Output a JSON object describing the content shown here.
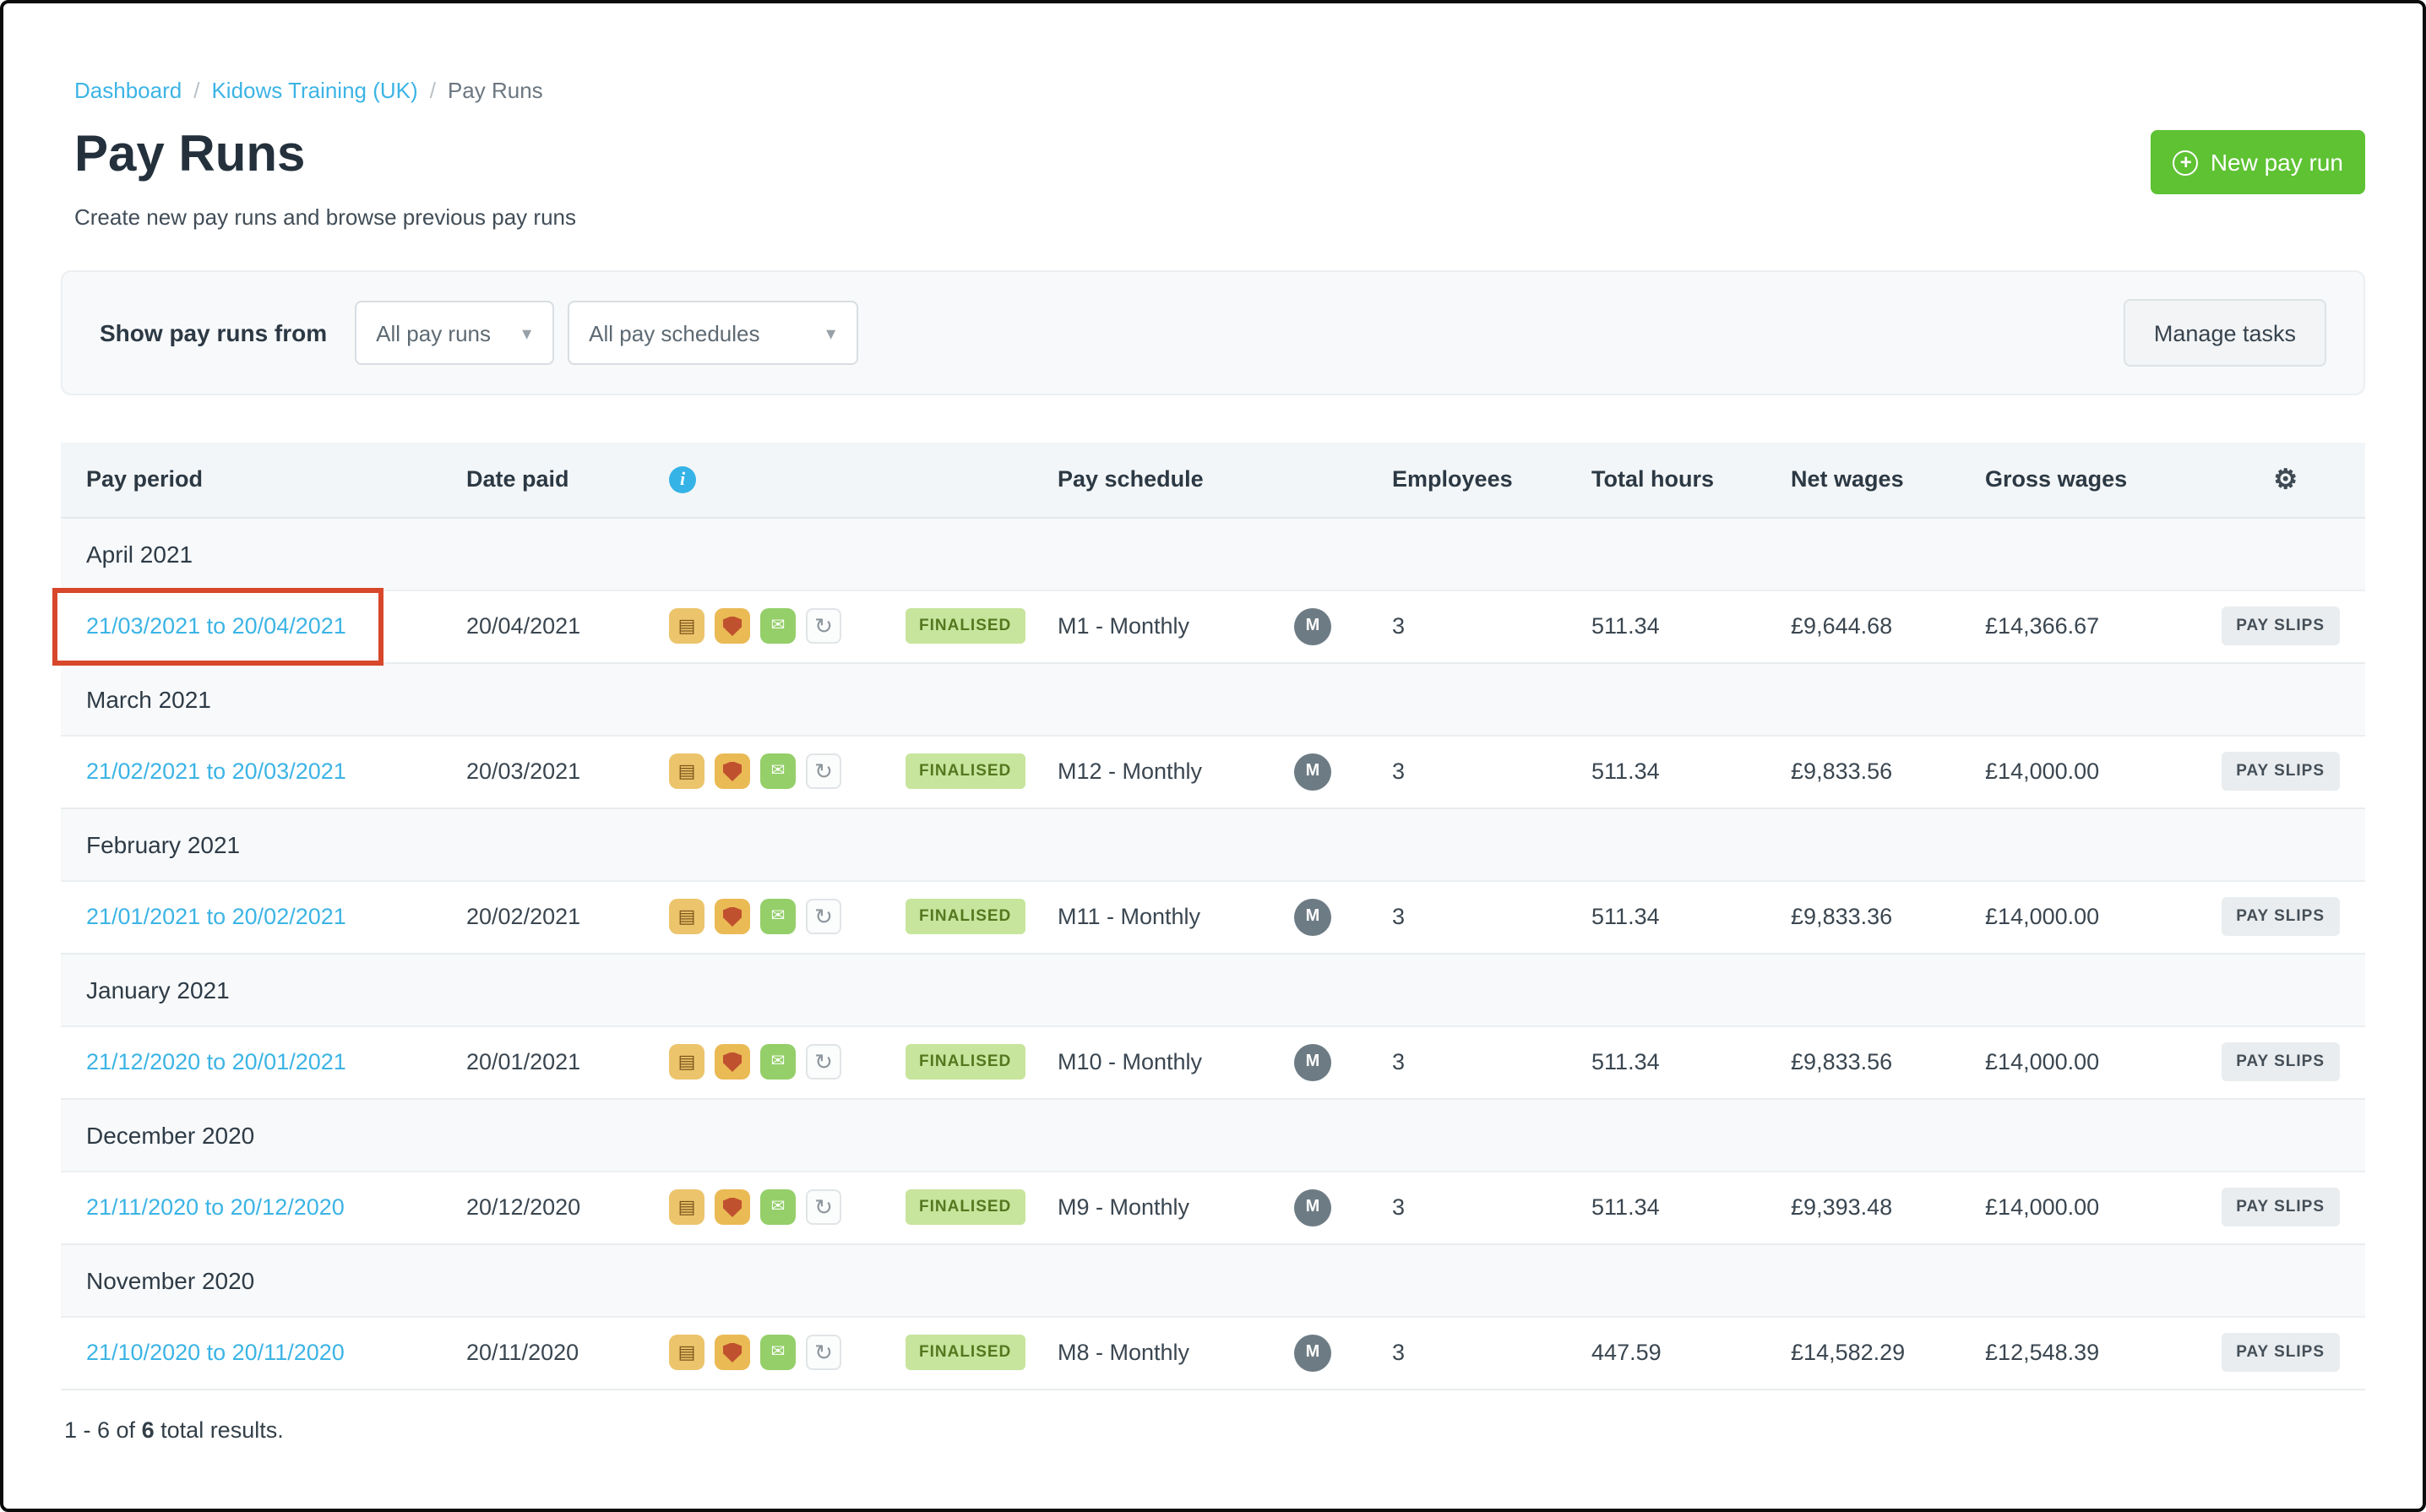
{
  "breadcrumb": {
    "separator": "/",
    "items": [
      {
        "label": "Dashboard"
      },
      {
        "label": "Kidows Training (UK)"
      },
      {
        "label": "Pay Runs"
      }
    ]
  },
  "header": {
    "title": "Pay Runs",
    "subtitle": "Create new pay runs and browse previous pay runs",
    "new_pay_run": "New pay run"
  },
  "filters": {
    "label": "Show pay runs from",
    "pay_runs_filter": "All pay runs",
    "pay_schedules_filter": "All pay schedules",
    "manage_tasks": "Manage tasks"
  },
  "table": {
    "columns": {
      "pay_period": "Pay period",
      "date_paid": "Date paid",
      "pay_schedule": "Pay schedule",
      "employees": "Employees",
      "total_hours": "Total hours",
      "net_wages": "Net wages",
      "gross_wages": "Gross wages"
    },
    "groups": [
      {
        "month": "April 2021",
        "rows": [
          {
            "pay_period": "21/03/2021 to 20/04/2021",
            "date_paid": "20/04/2021",
            "status": "FINALISED",
            "schedule": "M1 - Monthly",
            "schedule_badge": "M",
            "employees": "3",
            "total_hours": "511.34",
            "net_wages": "£9,644.68",
            "gross_wages": "£14,366.67",
            "action": "PAY SLIPS",
            "highlighted": true
          }
        ]
      },
      {
        "month": "March 2021",
        "rows": [
          {
            "pay_period": "21/02/2021 to 20/03/2021",
            "date_paid": "20/03/2021",
            "status": "FINALISED",
            "schedule": "M12 - Monthly",
            "schedule_badge": "M",
            "employees": "3",
            "total_hours": "511.34",
            "net_wages": "£9,833.56",
            "gross_wages": "£14,000.00",
            "action": "PAY SLIPS",
            "highlighted": false
          }
        ]
      },
      {
        "month": "February 2021",
        "rows": [
          {
            "pay_period": "21/01/2021 to 20/02/2021",
            "date_paid": "20/02/2021",
            "status": "FINALISED",
            "schedule": "M11 - Monthly",
            "schedule_badge": "M",
            "employees": "3",
            "total_hours": "511.34",
            "net_wages": "£9,833.36",
            "gross_wages": "£14,000.00",
            "action": "PAY SLIPS",
            "highlighted": false
          }
        ]
      },
      {
        "month": "January 2021",
        "rows": [
          {
            "pay_period": "21/12/2020 to 20/01/2021",
            "date_paid": "20/01/2021",
            "status": "FINALISED",
            "schedule": "M10 - Monthly",
            "schedule_badge": "M",
            "employees": "3",
            "total_hours": "511.34",
            "net_wages": "£9,833.56",
            "gross_wages": "£14,000.00",
            "action": "PAY SLIPS",
            "highlighted": false
          }
        ]
      },
      {
        "month": "December 2020",
        "rows": [
          {
            "pay_period": "21/11/2020 to 20/12/2020",
            "date_paid": "20/12/2020",
            "status": "FINALISED",
            "schedule": "M9 - Monthly",
            "schedule_badge": "M",
            "employees": "3",
            "total_hours": "511.34",
            "net_wages": "£9,393.48",
            "gross_wages": "£14,000.00",
            "action": "PAY SLIPS",
            "highlighted": false
          }
        ]
      },
      {
        "month": "November 2020",
        "rows": [
          {
            "pay_period": "21/10/2020 to 20/11/2020",
            "date_paid": "20/11/2020",
            "status": "FINALISED",
            "schedule": "M8 - Monthly",
            "schedule_badge": "M",
            "employees": "3",
            "total_hours": "447.59",
            "net_wages": "£14,582.29",
            "gross_wages": "£12,548.39",
            "action": "PAY SLIPS",
            "highlighted": false
          }
        ]
      }
    ]
  },
  "footer": {
    "range": "1 - 6 of",
    "total": "6",
    "suffix": "total results."
  },
  "icons": {
    "plus": "+",
    "info": "i",
    "gear": "⚙",
    "chevron": "▾",
    "row": [
      {
        "name": "payroll-journal-icon",
        "glyph": "▤",
        "style": "journal"
      },
      {
        "name": "pension-shield-icon",
        "glyph": "",
        "style": "shield"
      },
      {
        "name": "email-payslips-icon",
        "glyph": "✉",
        "style": "mail"
      },
      {
        "name": "reopen-payrun-icon",
        "glyph": "↻",
        "style": "refresh"
      }
    ]
  },
  "colors": {
    "accent_green": "#5ec233",
    "link_blue": "#3cb4e5",
    "finalised_bg": "#c7e59c",
    "annotation_red": "#d8472b",
    "badge_gray": "#6d7b84"
  }
}
